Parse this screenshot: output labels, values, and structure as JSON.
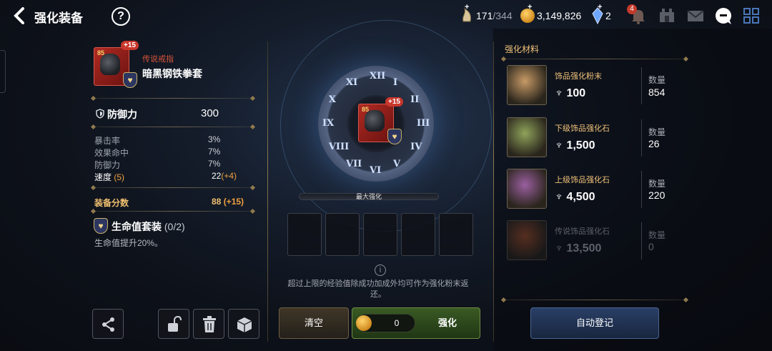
{
  "header": {
    "title": "强化装备",
    "help_label": "?",
    "stamina": {
      "current": "171",
      "max": "/344"
    },
    "gold": "3,149,826",
    "crystals": "2",
    "notification_count": "4"
  },
  "item": {
    "level": "85",
    "enhance": "+15",
    "rarity": "传说戒指",
    "name": "暗黑钢铁拳套",
    "main_stat": {
      "label": "防御力",
      "value": "300"
    },
    "sub_stats": [
      {
        "label": "暴击率",
        "value": "3%"
      },
      {
        "label": "效果命中",
        "value": "7%"
      },
      {
        "label": "防御力",
        "value": "7%"
      }
    ],
    "speed": {
      "label": "速度",
      "bonus": "(5)",
      "value": "22",
      "delta": "(+4)"
    },
    "score": {
      "label": "装备分数",
      "value": "88",
      "delta": "(+15)"
    },
    "set": {
      "name": "生命值套装",
      "progress": "(0/2)",
      "desc": "生命值提升20%。"
    }
  },
  "center": {
    "max_label": "最大强化",
    "numerals": [
      "XII",
      "I",
      "II",
      "III",
      "IV",
      "V",
      "VI",
      "VII",
      "VIII",
      "IX",
      "X",
      "XI"
    ],
    "note": "超过上限的经验值除成功加成外均可作为强化粉末返还。",
    "clear_label": "清空",
    "cost": "0",
    "enhance_label": "强化"
  },
  "materials": {
    "title": "强化材料",
    "qty_label": "数量",
    "items": [
      {
        "name": "饰品强化粉末",
        "cost": "100",
        "qty": "854",
        "color": "#c79a66"
      },
      {
        "name": "下级饰品强化石",
        "cost": "1,500",
        "qty": "26",
        "color": "#8fa35a"
      },
      {
        "name": "上级饰品强化石",
        "cost": "4,500",
        "qty": "220",
        "color": "#9a5fa0"
      },
      {
        "name": "传说饰品强化石",
        "cost": "13,500",
        "qty": "0",
        "color": "#b0532a"
      }
    ],
    "auto_label": "自动登记"
  }
}
